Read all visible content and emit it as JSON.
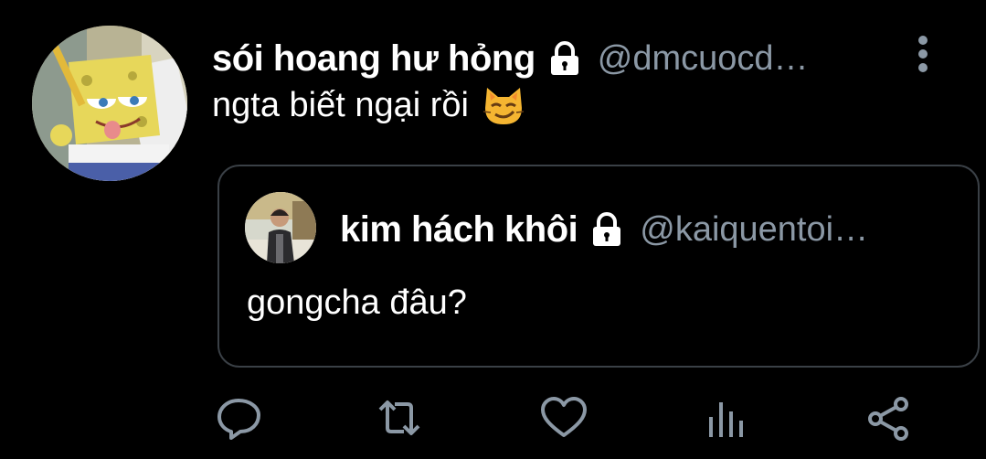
{
  "tweet": {
    "author": {
      "display_name": "sói hoang hư hỏng",
      "handle": "@dmcuocd…",
      "protected_icon": "lock-icon",
      "avatar": "spongebob-avatar"
    },
    "text": "ngta biết ngại rồi",
    "emoji": "😼",
    "more_icon": "more-vertical-icon"
  },
  "quoted_tweet": {
    "author": {
      "display_name": "kim hách khôi",
      "handle": "@kaiquentoi…",
      "protected_icon": "lock-icon",
      "avatar": "person-photo-avatar"
    },
    "text": "gongcha đâu?"
  },
  "actions": [
    {
      "name": "reply",
      "icon": "reply-icon"
    },
    {
      "name": "retweet",
      "icon": "retweet-icon"
    },
    {
      "name": "like",
      "icon": "heart-icon"
    },
    {
      "name": "analytics",
      "icon": "analytics-icon"
    },
    {
      "name": "share",
      "icon": "share-icon"
    }
  ],
  "colors": {
    "background": "#000000",
    "text": "#ffffff",
    "secondary": "#8b98a5",
    "border": "#3a4046",
    "icon": "#8b98a5"
  }
}
